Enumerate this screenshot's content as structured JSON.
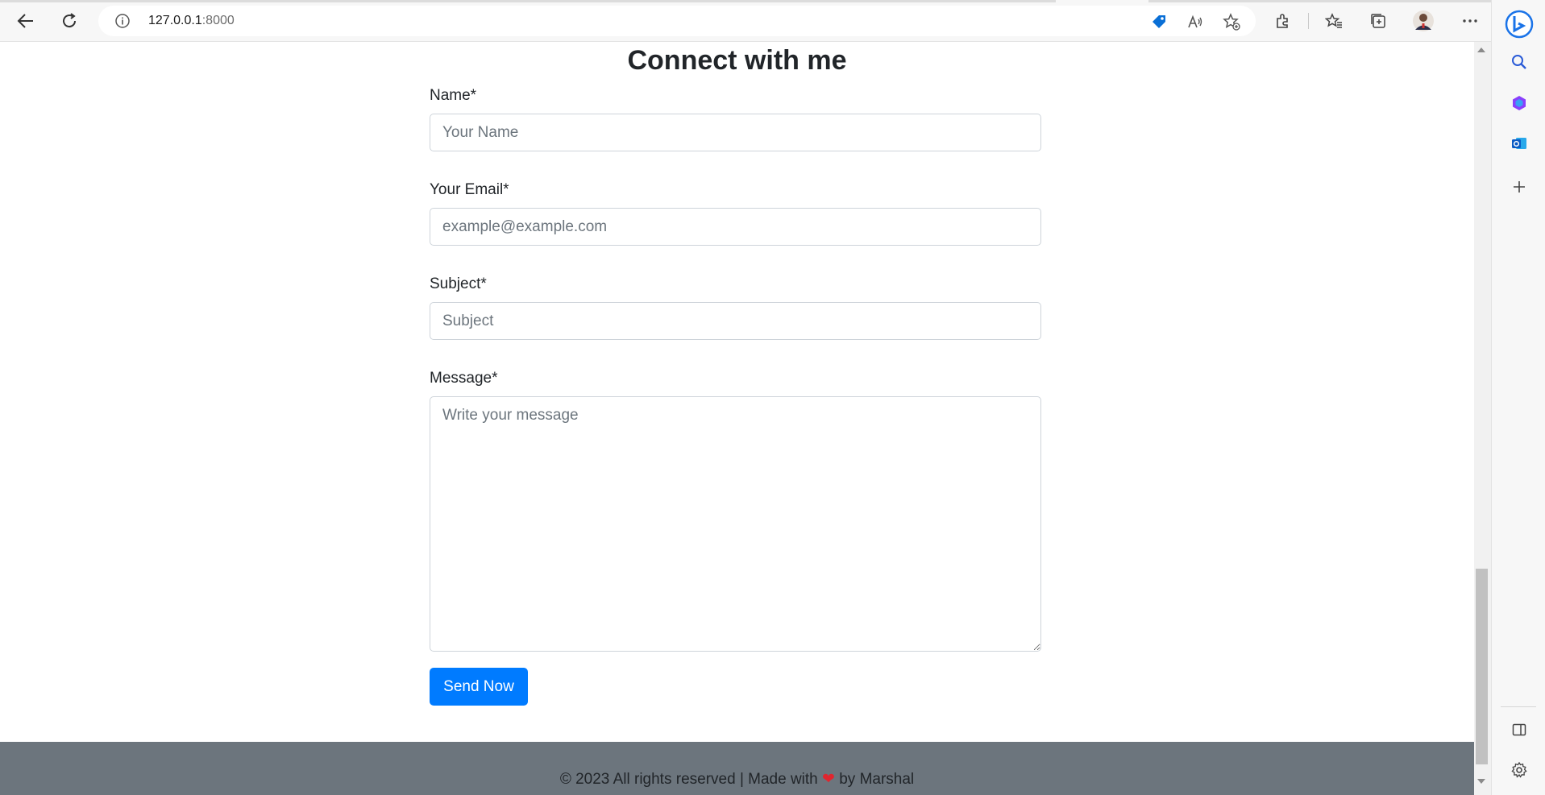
{
  "browser": {
    "url_host": "127.0.0.1",
    "url_port": ":8000",
    "back_icon": "back-arrow-icon",
    "refresh_icon": "refresh-icon",
    "info_icon": "site-info-icon",
    "toolbar_icons": [
      "tag-icon",
      "read-aloud-icon",
      "add-favorite-icon",
      "extensions-icon",
      "favorites-icon",
      "collections-icon",
      "profile-avatar",
      "more-icon",
      "bing-icon"
    ],
    "sidebar_icons": [
      "search-icon",
      "office-icon",
      "outlook-icon",
      "add-icon",
      "split-screen-icon",
      "settings-icon"
    ],
    "accent_color": "#0078d4"
  },
  "page": {
    "title": "Connect with me",
    "form": {
      "name_label": "Name*",
      "name_placeholder": "Your Name",
      "email_label": "Your Email*",
      "email_placeholder": "example@example.com",
      "subject_label": "Subject*",
      "subject_placeholder": "Subject",
      "message_label": "Message*",
      "message_placeholder": "Write your message",
      "submit_label": "Send Now",
      "submit_color": "#007bff"
    },
    "footer": {
      "text_before": "© 2023 All rights reserved | Made with",
      "heart": "❤",
      "text_after": "by Marshal",
      "background": "#6c757d"
    }
  }
}
